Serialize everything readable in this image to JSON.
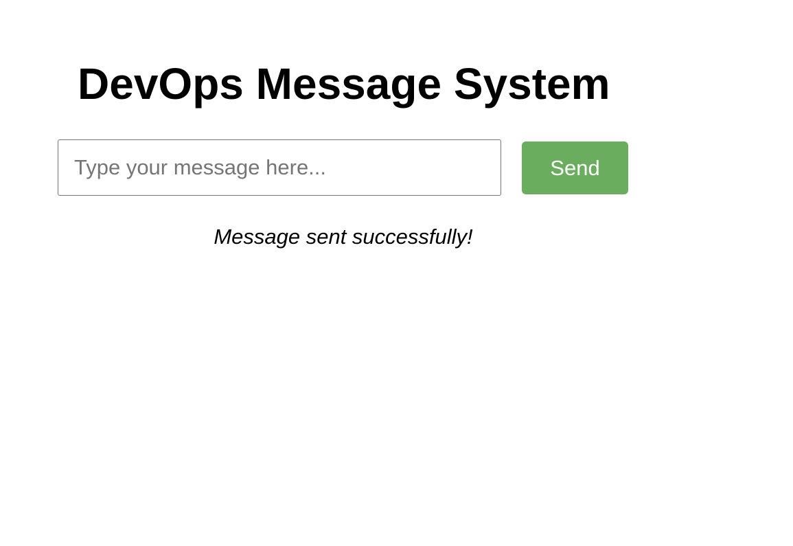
{
  "header": {
    "title": "DevOps Message System"
  },
  "composer": {
    "input_value": "",
    "input_placeholder": "Type your message here...",
    "send_label": "Send"
  },
  "status": {
    "text": "Message sent successfully!"
  },
  "colors": {
    "send_button_bg": "#6aad5e"
  }
}
